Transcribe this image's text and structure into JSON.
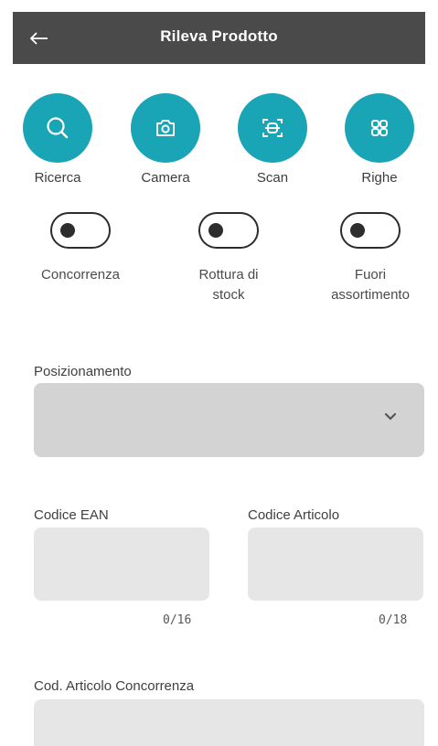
{
  "header": {
    "title": "Rileva Prodotto",
    "back_icon": "arrow-left-icon",
    "background": "#4a4a4a"
  },
  "actions": [
    {
      "label": "Ricerca",
      "icon": "search-icon"
    },
    {
      "label": "Camera",
      "icon": "camera-icon"
    },
    {
      "label": "Scan",
      "icon": "scan-icon"
    },
    {
      "label": "Righe",
      "icon": "grid-icon"
    }
  ],
  "accent_color": "#1aa5b7",
  "toggles": [
    {
      "label_line1": "Concorrenza",
      "label_line2": "",
      "on": false
    },
    {
      "label_line1": "Rottura di",
      "label_line2": "stock",
      "on": false
    },
    {
      "label_line1": "Fuori",
      "label_line2": "assortimento",
      "on": false
    }
  ],
  "form": {
    "posizionamento": {
      "label": "Posizionamento",
      "value": ""
    },
    "codice_ean": {
      "label": "Codice EAN",
      "value": "",
      "counter": "0/16"
    },
    "codice_articolo": {
      "label": "Codice Articolo",
      "value": "",
      "counter": "0/18"
    },
    "cod_articolo_concorrenza": {
      "label": "Cod. Articolo Concorrenza",
      "value": ""
    }
  }
}
